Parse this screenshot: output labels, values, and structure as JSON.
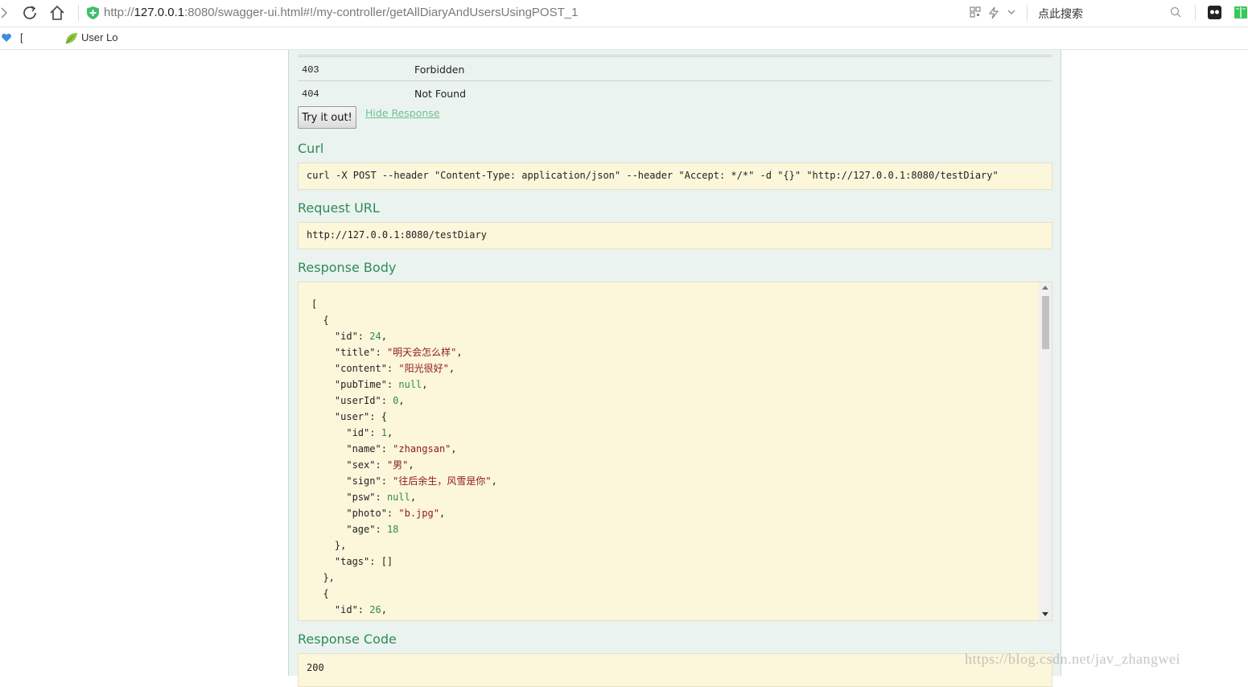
{
  "browser": {
    "url_prefix": "http://",
    "url_host": "127.0.0.1",
    "url_rest": ":8080/swagger-ui.html#!/my-controller/getAllDiaryAndUsersUsingPOST_1",
    "search_placeholder": "点此搜索",
    "bookmarks": [
      {
        "label": "[",
        "icon": "heart-icon"
      },
      {
        "label": "User Lo",
        "icon": "leaf-icon"
      }
    ]
  },
  "responses_table": [
    {
      "code": "403",
      "reason": "Forbidden"
    },
    {
      "code": "404",
      "reason": "Not Found"
    }
  ],
  "actions": {
    "try_label": "Try it out!",
    "hide_label": "Hide Response"
  },
  "curl": {
    "heading": "Curl",
    "command": "curl -X POST --header \"Content-Type: application/json\" --header \"Accept: */*\" -d \"{}\" \"http://127.0.0.1:8080/testDiary\""
  },
  "request_url": {
    "heading": "Request URL",
    "value": "http://127.0.0.1:8080/testDiary"
  },
  "response_body": {
    "heading": "Response Body",
    "lines": [
      [
        [
          "p",
          "["
        ]
      ],
      [
        [
          "p",
          "  {"
        ]
      ],
      [
        [
          "k",
          "    \"id\""
        ],
        [
          "p",
          ": "
        ],
        [
          "n",
          "24"
        ],
        [
          "p",
          ","
        ]
      ],
      [
        [
          "k",
          "    \"title\""
        ],
        [
          "p",
          ": "
        ],
        [
          "s",
          "\"明天会怎么样\""
        ],
        [
          "p",
          ","
        ]
      ],
      [
        [
          "k",
          "    \"content\""
        ],
        [
          "p",
          ": "
        ],
        [
          "s",
          "\"阳光很好\""
        ],
        [
          "p",
          ","
        ]
      ],
      [
        [
          "k",
          "    \"pubTime\""
        ],
        [
          "p",
          ": "
        ],
        [
          "n",
          "null"
        ],
        [
          "p",
          ","
        ]
      ],
      [
        [
          "k",
          "    \"userId\""
        ],
        [
          "p",
          ": "
        ],
        [
          "n",
          "0"
        ],
        [
          "p",
          ","
        ]
      ],
      [
        [
          "k",
          "    \"user\""
        ],
        [
          "p",
          ": {"
        ]
      ],
      [
        [
          "k",
          "      \"id\""
        ],
        [
          "p",
          ": "
        ],
        [
          "n",
          "1"
        ],
        [
          "p",
          ","
        ]
      ],
      [
        [
          "k",
          "      \"name\""
        ],
        [
          "p",
          ": "
        ],
        [
          "s",
          "\"zhangsan\""
        ],
        [
          "p",
          ","
        ]
      ],
      [
        [
          "k",
          "      \"sex\""
        ],
        [
          "p",
          ": "
        ],
        [
          "s",
          "\"男\""
        ],
        [
          "p",
          ","
        ]
      ],
      [
        [
          "k",
          "      \"sign\""
        ],
        [
          "p",
          ": "
        ],
        [
          "s",
          "\"往后余生，风雪是你\""
        ],
        [
          "p",
          ","
        ]
      ],
      [
        [
          "k",
          "      \"psw\""
        ],
        [
          "p",
          ": "
        ],
        [
          "n",
          "null"
        ],
        [
          "p",
          ","
        ]
      ],
      [
        [
          "k",
          "      \"photo\""
        ],
        [
          "p",
          ": "
        ],
        [
          "s",
          "\"b.jpg\""
        ],
        [
          "p",
          ","
        ]
      ],
      [
        [
          "k",
          "      \"age\""
        ],
        [
          "p",
          ": "
        ],
        [
          "n",
          "18"
        ]
      ],
      [
        [
          "p",
          "    },"
        ]
      ],
      [
        [
          "k",
          "    \"tags\""
        ],
        [
          "p",
          ": []"
        ]
      ],
      [
        [
          "p",
          "  },"
        ]
      ],
      [
        [
          "p",
          "  {"
        ]
      ],
      [
        [
          "k",
          "    \"id\""
        ],
        [
          "p",
          ": "
        ],
        [
          "n",
          "26"
        ],
        [
          "p",
          ","
        ]
      ]
    ]
  },
  "response_code": {
    "heading": "Response Code",
    "value": "200"
  },
  "watermark": "https://blog.csdn.net/jav_zhangwei",
  "colors": {
    "panel_bg": "#ebf3f0",
    "code_bg": "#fcf6db",
    "heading": "#2e8b57",
    "string": "#8b1a1a",
    "number": "#2e8b57"
  }
}
